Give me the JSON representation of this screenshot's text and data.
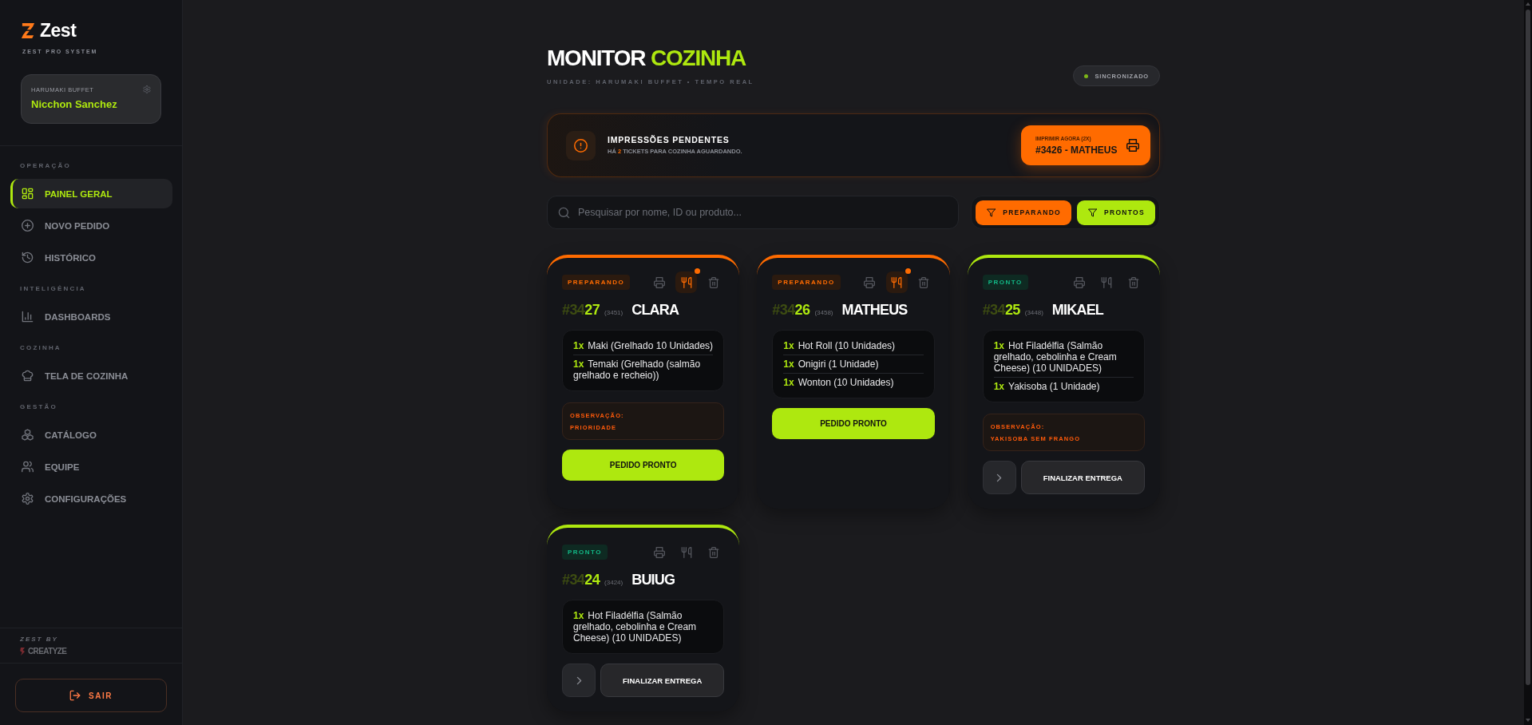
{
  "sidebar": {
    "logo": {
      "text": "Zest",
      "tagline": "ZEST PRO SYSTEM"
    },
    "account": {
      "unit": "HARUMAKI BUFFET",
      "user": "Nicchon Sanchez"
    },
    "sections": [
      {
        "title": "OPERAÇÃO",
        "items": [
          {
            "label": "PAINEL GERAL",
            "selected": true
          },
          {
            "label": "NOVO PEDIDO",
            "selected": false
          },
          {
            "label": "HISTÓRICO",
            "selected": false
          }
        ]
      },
      {
        "title": "INTELIGÊNCIA",
        "items": [
          {
            "label": "DASHBOARDS",
            "selected": false
          }
        ]
      },
      {
        "title": "COZINHA",
        "items": [
          {
            "label": "TELA DE COZINHA",
            "selected": false
          }
        ]
      },
      {
        "title": "GESTÃO",
        "items": [
          {
            "label": "CATÁLOGO",
            "selected": false
          },
          {
            "label": "EQUIPE",
            "selected": false
          },
          {
            "label": "CONFIGURAÇÕES",
            "selected": false
          }
        ]
      }
    ],
    "credit": {
      "caption": "ZEST BY",
      "brand": "CREATYZE"
    },
    "logout": "SAIR"
  },
  "header": {
    "title": "MONITOR",
    "title_accent": "COZINHA",
    "subtitle": "UNIDADE: HARUMAKI BUFFET • TEMPO REAL",
    "sync": {
      "label": "SINCRONIZADO",
      "on": true
    }
  },
  "print_notice": {
    "title": "IMPRESSÕES PENDENTES",
    "message": "HÁ **2** TICKETS PARA COZINHA AGUARDANDO.",
    "button": {
      "caption": "IMPRIMIR AGORA (2X)",
      "label": "#3426 - MATHEUS"
    }
  },
  "search": {
    "placeholder": "Pesquisar por nome, ID ou produto..."
  },
  "filters": [
    {
      "label": "PREPARANDO",
      "kind": "preparing",
      "selected": true
    },
    {
      "label": "PRONTOS",
      "kind": "ready",
      "selected": true
    }
  ],
  "orders": [
    {
      "kind": "preparing",
      "status": "PREPARANDO",
      "kitchen_alert": true,
      "number_prefix": "#34",
      "number": "27",
      "ref": "(3451)",
      "customer": "CLARA",
      "items": [
        {
          "qty": "1x",
          "name": "Maki (Grelhado 10 Unidades)"
        },
        {
          "qty": "1x",
          "name": "Temaki (Grelhado (salmão grelhado e recheio))"
        }
      ],
      "note": {
        "label": "OBSERVAÇÃO:",
        "text": "PRIORIDADE"
      },
      "actions": [
        {
          "kind": "ready",
          "label": "PEDIDO PRONTO"
        }
      ]
    },
    {
      "kind": "preparing",
      "status": "PREPARANDO",
      "kitchen_alert": true,
      "number_prefix": "#34",
      "number": "26",
      "ref": "(3458)",
      "customer": "MATHEUS",
      "items": [
        {
          "qty": "1x",
          "name": "Hot Roll (10 Unidades)"
        },
        {
          "qty": "1x",
          "name": "Onigiri (1 Unidade)"
        },
        {
          "qty": "1x",
          "name": "Wonton (10 Unidades)"
        }
      ],
      "actions": [
        {
          "kind": "ready",
          "label": "PEDIDO PRONTO"
        }
      ]
    },
    {
      "kind": "ready",
      "status": "PRONTO",
      "kitchen_alert": false,
      "number_prefix": "#34",
      "number": "25",
      "ref": "(3448)",
      "customer": "MIKAEL",
      "items": [
        {
          "qty": "1x",
          "name": "Hot Filadélfia (Salmão grelhado, cebolinha e Cream Cheese) (10 UNIDADES)"
        },
        {
          "qty": "1x",
          "name": "Yakisoba (1 Unidade)"
        }
      ],
      "note": {
        "label": "OBSERVAÇÃO:",
        "text": "YAKISOBA SEM FRANGO"
      },
      "actions": [
        {
          "kind": "next"
        },
        {
          "kind": "finish",
          "label": "FINALIZAR ENTREGA"
        }
      ]
    },
    {
      "kind": "ready",
      "status": "PRONTO",
      "kitchen_alert": false,
      "number_prefix": "#34",
      "number": "24",
      "ref": "(3424)",
      "customer": "BUIUG",
      "items": [
        {
          "qty": "1x",
          "name": "Hot Filadélfia (Salmão grelhado, cebolinha e Cream Cheese) (10 UNIDADES)"
        }
      ],
      "actions": [
        {
          "kind": "next"
        },
        {
          "kind": "finish",
          "label": "FINALIZAR ENTREGA"
        }
      ]
    }
  ]
}
